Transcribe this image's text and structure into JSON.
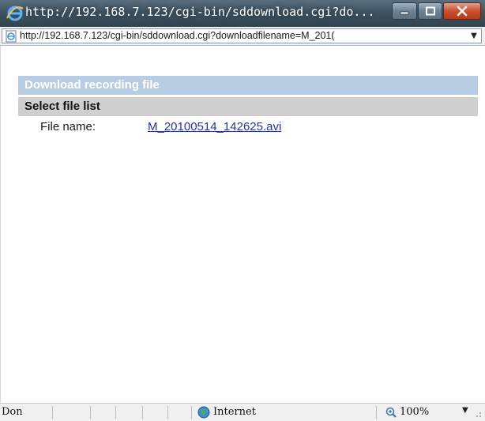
{
  "window": {
    "title": "http://192.168.7.123/cgi-bin/sddownload.cgi?do...",
    "icon": "internet-explorer-icon"
  },
  "address_bar": {
    "url": "http://192.168.7.123/cgi-bin/sddownload.cgi?downloadfilename=M_201(",
    "dropdown_icon": "chevron-down-icon"
  },
  "page": {
    "header": "Download recording file",
    "section_title": "Select file list",
    "file_label": "File name:",
    "file_link": "M_20100514_142625.avi"
  },
  "status_bar": {
    "status": "Don",
    "zone": "Internet",
    "zoom": "100%"
  },
  "colors": {
    "header_bg": "#b8cce3",
    "section_bg": "#cfcfcf",
    "link": "#2233aa",
    "close_button": "#cc4e2f"
  }
}
